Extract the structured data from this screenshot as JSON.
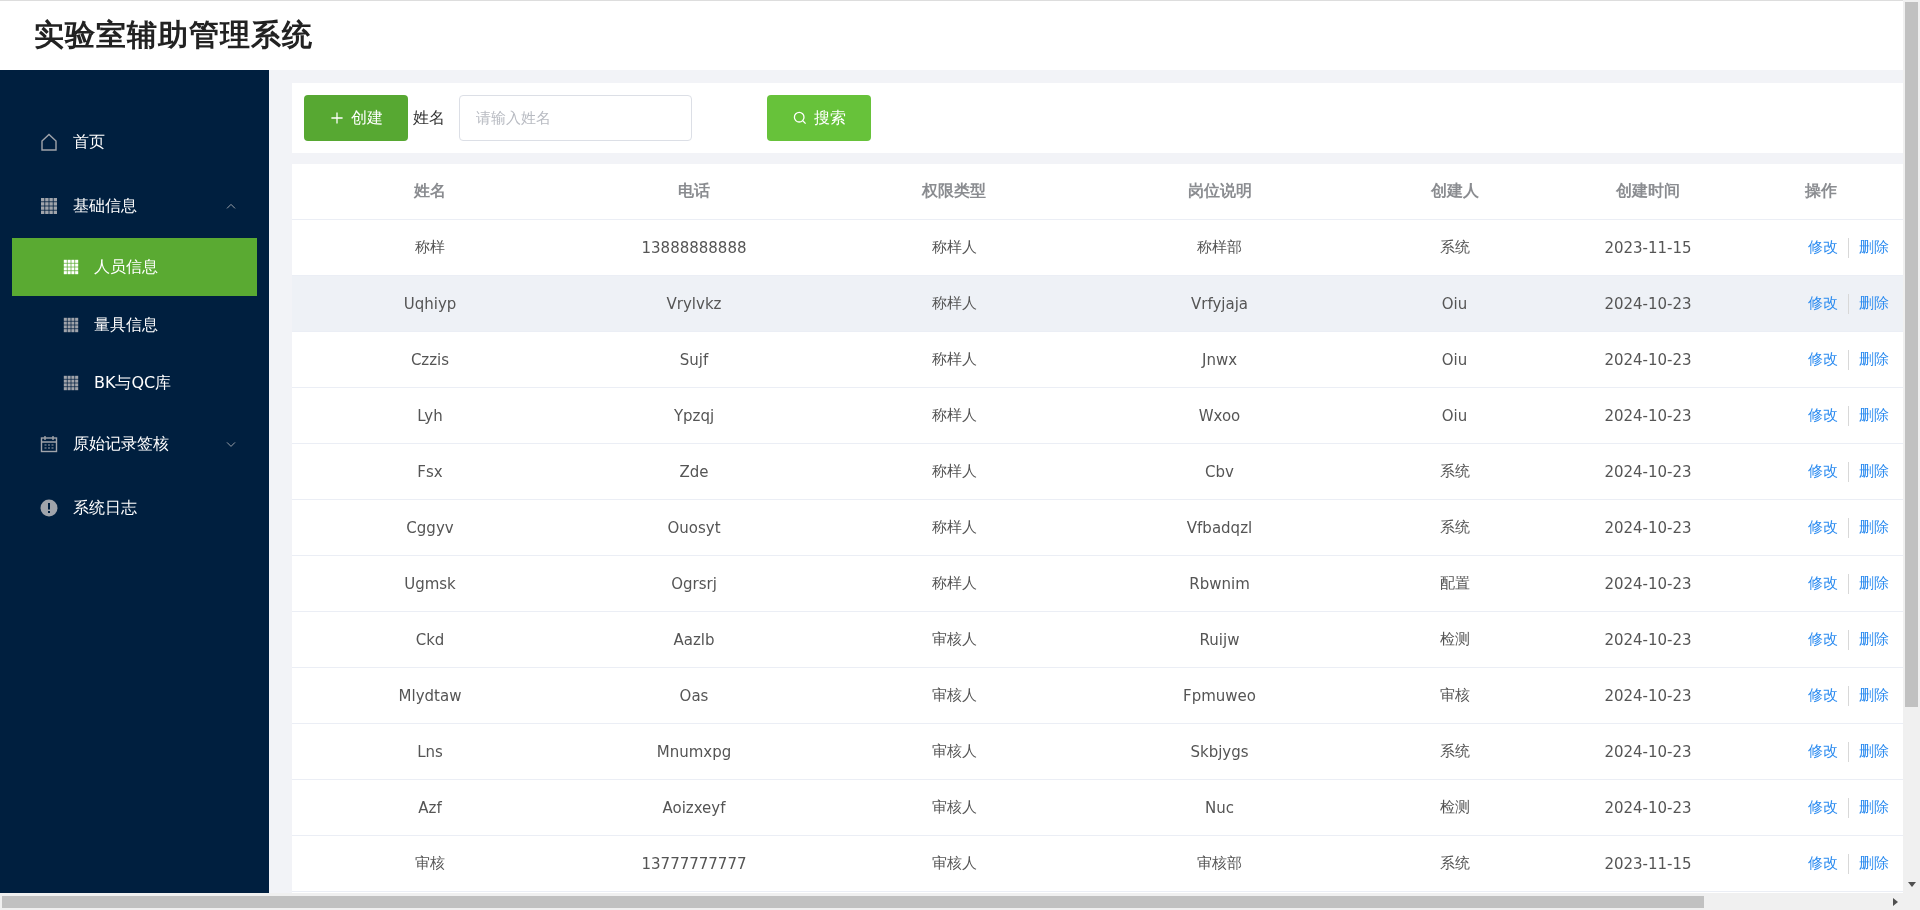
{
  "header": {
    "title": "实验室辅助管理系统"
  },
  "sidebar": {
    "items": [
      {
        "label": "首页",
        "kind": "home",
        "selected": false
      },
      {
        "label": "基础信息",
        "kind": "grid",
        "selected": false,
        "expanded": true,
        "children": [
          {
            "label": "人员信息",
            "kind": "grid",
            "selected": true
          },
          {
            "label": "量具信息",
            "kind": "grid",
            "selected": false
          },
          {
            "label": "BK与QC库",
            "kind": "grid",
            "selected": false
          }
        ]
      },
      {
        "label": "原始记录签核",
        "kind": "calendar",
        "selected": false,
        "expanded": false
      },
      {
        "label": "系统日志",
        "kind": "alert",
        "selected": false
      }
    ]
  },
  "toolbar": {
    "create_button": "创建",
    "name_label": "姓名",
    "name_field": {
      "placeholder": "请输入姓名"
    },
    "search_button": "搜索"
  },
  "table": {
    "columns": [
      "姓名",
      "电话",
      "权限类型",
      "岗位说明",
      "创建人",
      "创建时间",
      "操作"
    ],
    "rows": [
      {
        "cells": [
          "称样",
          "13888888888",
          "称样人",
          "称样部",
          "系统",
          "2023-11-15"
        ],
        "actions": [
          "修改",
          "删除"
        ],
        "hovered": false
      },
      {
        "cells": [
          "Uqhiyp",
          "Vrylvkz",
          "称样人",
          "Vrfyjaja",
          "Oiu",
          "2024-10-23"
        ],
        "actions": [
          "修改",
          "删除"
        ],
        "hovered": true
      },
      {
        "cells": [
          "Czzis",
          "Sujf",
          "称样人",
          "Jnwx",
          "Oiu",
          "2024-10-23"
        ],
        "actions": [
          "修改",
          "删除"
        ],
        "hovered": false
      },
      {
        "cells": [
          "Lyh",
          "Ypzqj",
          "称样人",
          "Wxoo",
          "Oiu",
          "2024-10-23"
        ],
        "actions": [
          "修改",
          "删除"
        ],
        "hovered": false
      },
      {
        "cells": [
          "Fsx",
          "Zde",
          "称样人",
          "Cbv",
          "系统",
          "2024-10-23"
        ],
        "actions": [
          "修改",
          "删除"
        ],
        "hovered": false
      },
      {
        "cells": [
          "Cggyv",
          "Ouosyt",
          "称样人",
          "Vfbadqzl",
          "系统",
          "2024-10-23"
        ],
        "actions": [
          "修改",
          "删除"
        ],
        "hovered": false
      },
      {
        "cells": [
          "Ugmsk",
          "Ogrsrj",
          "称样人",
          "Rbwnim",
          "配置",
          "2024-10-23"
        ],
        "actions": [
          "修改",
          "删除"
        ],
        "hovered": false
      },
      {
        "cells": [
          "Ckd",
          "Aazlb",
          "审核人",
          "Ruijw",
          "检测",
          "2024-10-23"
        ],
        "actions": [
          "修改",
          "删除"
        ],
        "hovered": false
      },
      {
        "cells": [
          "Mlydtaw",
          "Oas",
          "审核人",
          "Fpmuweo",
          "审核",
          "2024-10-23"
        ],
        "actions": [
          "修改",
          "删除"
        ],
        "hovered": false
      },
      {
        "cells": [
          "Lns",
          "Mnumxpg",
          "审核人",
          "Skbjygs",
          "系统",
          "2024-10-23"
        ],
        "actions": [
          "修改",
          "删除"
        ],
        "hovered": false
      },
      {
        "cells": [
          "Azf",
          "Aoizxeyf",
          "审核人",
          "Nuc",
          "检测",
          "2024-10-23"
        ],
        "actions": [
          "修改",
          "删除"
        ],
        "hovered": false
      },
      {
        "cells": [
          "审核",
          "13777777777",
          "审核人",
          "审核部",
          "系统",
          "2023-11-15"
        ],
        "actions": [
          "修改",
          "删除"
        ],
        "hovered": false
      }
    ]
  }
}
